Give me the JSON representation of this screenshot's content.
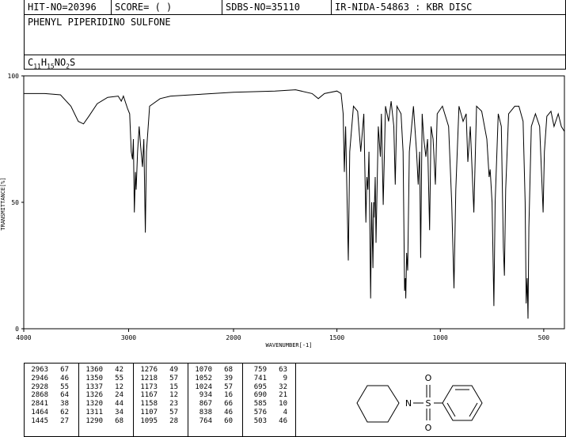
{
  "header": {
    "hit_no": "HIT-NO=20396",
    "score": "SCORE=  (   )",
    "sdbs_no": "SDBS-NO=35110",
    "ir_nida": "IR-NIDA-54863 : KBR DISC"
  },
  "compound_name": "PHENYL PIPERIDINO SULFONE",
  "formula": {
    "c": "C",
    "c_n": "11",
    "h": "H",
    "h_n": "15",
    "rest": "NO",
    "o_n": "2",
    "s": "S"
  },
  "chart_data": {
    "type": "line",
    "xlabel": "WAVENUMBER[-1]",
    "ylabel": "TRANSMITTANCE[%]",
    "xlim": [
      4000,
      400
    ],
    "ylim": [
      0,
      100
    ],
    "x_ticks": [
      4000,
      3000,
      2000,
      1500,
      1000,
      500
    ],
    "y_ticks": [
      0,
      50,
      100
    ],
    "series": [
      {
        "points": [
          [
            4000,
            93
          ],
          [
            3800,
            93
          ],
          [
            3650,
            92.5
          ],
          [
            3550,
            88
          ],
          [
            3480,
            82
          ],
          [
            3430,
            81
          ],
          [
            3380,
            84
          ],
          [
            3300,
            89
          ],
          [
            3200,
            91.5
          ],
          [
            3100,
            92
          ],
          [
            3070,
            90
          ],
          [
            3050,
            92
          ],
          [
            3010,
            87
          ],
          [
            2990,
            85
          ],
          [
            2975,
            70
          ],
          [
            2963,
            67
          ],
          [
            2955,
            75
          ],
          [
            2946,
            46
          ],
          [
            2935,
            62
          ],
          [
            2928,
            55
          ],
          [
            2915,
            70
          ],
          [
            2900,
            80
          ],
          [
            2885,
            72
          ],
          [
            2868,
            64
          ],
          [
            2855,
            75
          ],
          [
            2841,
            38
          ],
          [
            2830,
            70
          ],
          [
            2800,
            88
          ],
          [
            2700,
            91
          ],
          [
            2600,
            92
          ],
          [
            2400,
            92.5
          ],
          [
            2200,
            93
          ],
          [
            2000,
            93.5
          ],
          [
            1800,
            94
          ],
          [
            1700,
            94.5
          ],
          [
            1620,
            93
          ],
          [
            1590,
            91
          ],
          [
            1560,
            93
          ],
          [
            1500,
            94
          ],
          [
            1480,
            93
          ],
          [
            1470,
            85
          ],
          [
            1464,
            62
          ],
          [
            1458,
            80
          ],
          [
            1445,
            27
          ],
          [
            1438,
            70
          ],
          [
            1420,
            88
          ],
          [
            1400,
            86
          ],
          [
            1385,
            70
          ],
          [
            1370,
            85
          ],
          [
            1360,
            42
          ],
          [
            1355,
            60
          ],
          [
            1350,
            55
          ],
          [
            1345,
            70
          ],
          [
            1337,
            12
          ],
          [
            1332,
            50
          ],
          [
            1326,
            24
          ],
          [
            1322,
            50
          ],
          [
            1320,
            44
          ],
          [
            1315,
            60
          ],
          [
            1311,
            34
          ],
          [
            1300,
            80
          ],
          [
            1290,
            68
          ],
          [
            1285,
            85
          ],
          [
            1276,
            49
          ],
          [
            1265,
            88
          ],
          [
            1250,
            82
          ],
          [
            1238,
            90
          ],
          [
            1225,
            80
          ],
          [
            1218,
            57
          ],
          [
            1210,
            88
          ],
          [
            1190,
            85
          ],
          [
            1180,
            70
          ],
          [
            1173,
            15
          ],
          [
            1169,
            20
          ],
          [
            1167,
            12
          ],
          [
            1163,
            30
          ],
          [
            1158,
            23
          ],
          [
            1150,
            70
          ],
          [
            1130,
            88
          ],
          [
            1115,
            70
          ],
          [
            1107,
            57
          ],
          [
            1100,
            70
          ],
          [
            1095,
            28
          ],
          [
            1088,
            85
          ],
          [
            1080,
            75
          ],
          [
            1070,
            68
          ],
          [
            1062,
            75
          ],
          [
            1052,
            39
          ],
          [
            1045,
            80
          ],
          [
            1035,
            75
          ],
          [
            1024,
            57
          ],
          [
            1015,
            85
          ],
          [
            990,
            88
          ],
          [
            960,
            80
          ],
          [
            945,
            50
          ],
          [
            934,
            16
          ],
          [
            925,
            55
          ],
          [
            910,
            88
          ],
          [
            890,
            82
          ],
          [
            875,
            85
          ],
          [
            867,
            66
          ],
          [
            855,
            80
          ],
          [
            838,
            46
          ],
          [
            825,
            88
          ],
          [
            800,
            86
          ],
          [
            775,
            75
          ],
          [
            764,
            60
          ],
          [
            759,
            63
          ],
          [
            750,
            50
          ],
          [
            741,
            9
          ],
          [
            735,
            50
          ],
          [
            720,
            85
          ],
          [
            705,
            80
          ],
          [
            695,
            32
          ],
          [
            690,
            21
          ],
          [
            684,
            55
          ],
          [
            670,
            85
          ],
          [
            640,
            88
          ],
          [
            620,
            88
          ],
          [
            600,
            82
          ],
          [
            590,
            50
          ],
          [
            585,
            10
          ],
          [
            580,
            20
          ],
          [
            576,
            4
          ],
          [
            572,
            40
          ],
          [
            560,
            80
          ],
          [
            540,
            85
          ],
          [
            520,
            80
          ],
          [
            510,
            60
          ],
          [
            503,
            46
          ],
          [
            497,
            70
          ],
          [
            485,
            84
          ],
          [
            465,
            86
          ],
          [
            450,
            80
          ],
          [
            430,
            85
          ],
          [
            415,
            80
          ],
          [
            400,
            78
          ]
        ]
      }
    ]
  },
  "peaks": [
    [
      [
        "2963",
        "67"
      ],
      [
        "2946",
        "46"
      ],
      [
        "2928",
        "55"
      ],
      [
        "2868",
        "64"
      ],
      [
        "2841",
        "38"
      ],
      [
        "1464",
        "62"
      ],
      [
        "1445",
        "27"
      ]
    ],
    [
      [
        "1360",
        "42"
      ],
      [
        "1350",
        "55"
      ],
      [
        "1337",
        "12"
      ],
      [
        "1326",
        "24"
      ],
      [
        "1320",
        "44"
      ],
      [
        "1311",
        "34"
      ],
      [
        "1290",
        "68"
      ]
    ],
    [
      [
        "1276",
        "49"
      ],
      [
        "1218",
        "57"
      ],
      [
        "1173",
        "15"
      ],
      [
        "1167",
        "12"
      ],
      [
        "1158",
        "23"
      ],
      [
        "1107",
        "57"
      ],
      [
        "1095",
        "28"
      ]
    ],
    [
      [
        "1070",
        "68"
      ],
      [
        "1052",
        "39"
      ],
      [
        "1024",
        "57"
      ],
      [
        "934",
        "16"
      ],
      [
        "867",
        "66"
      ],
      [
        "838",
        "46"
      ],
      [
        "764",
        "60"
      ]
    ],
    [
      [
        "759",
        "63"
      ],
      [
        "741",
        "9"
      ],
      [
        "695",
        "32"
      ],
      [
        "690",
        "21"
      ],
      [
        "585",
        "10"
      ],
      [
        "576",
        "4"
      ],
      [
        "503",
        "46"
      ]
    ]
  ],
  "structure_labels": {
    "n": "N",
    "s": "S",
    "o_top": "O",
    "o_bottom": "O"
  }
}
